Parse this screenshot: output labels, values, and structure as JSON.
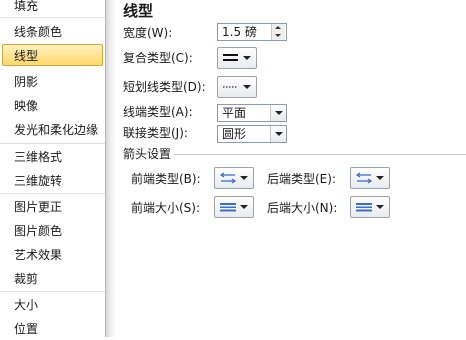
{
  "sidebar": {
    "items": [
      {
        "label": "填充"
      },
      {
        "label": "线条颜色"
      },
      {
        "label": "线型"
      },
      {
        "label": "阴影"
      },
      {
        "label": "映像"
      },
      {
        "label": "发光和柔化边缘"
      },
      {
        "label": "三维格式"
      },
      {
        "label": "三维旋转"
      },
      {
        "label": "图片更正"
      },
      {
        "label": "图片颜色"
      },
      {
        "label": "艺术效果"
      },
      {
        "label": "裁剪"
      },
      {
        "label": "大小"
      },
      {
        "label": "位置"
      }
    ],
    "selected": "线型"
  },
  "main": {
    "title": "线型",
    "width_label": "宽度(W):",
    "width_value": "1.5 磅",
    "compound_label": "复合类型(C):",
    "dash_label": "短划线类型(D):",
    "cap_label": "线端类型(A):",
    "cap_value": "平面",
    "join_label": "联接类型(J):",
    "join_value": "圆形",
    "arrow_section": "箭头设置",
    "begin_type_label": "前端类型(B):",
    "end_type_label": "后端类型(E):",
    "begin_size_label": "前端大小(S):",
    "end_size_label": "后端大小(N):"
  },
  "colors": {
    "selected_fill": "#ffd86b",
    "selected_border": "#d3a838",
    "arrow_icon_blue": "#3a6fd0"
  }
}
